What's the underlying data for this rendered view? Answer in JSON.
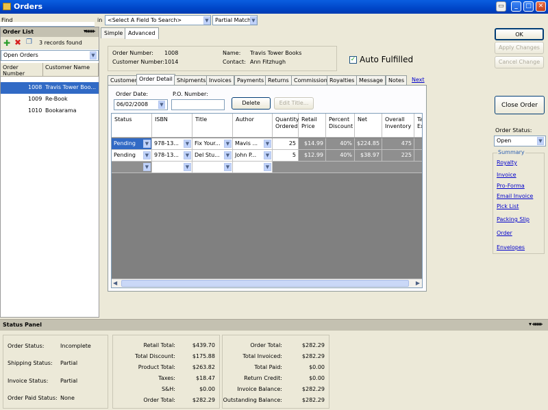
{
  "window": {
    "title": "Orders"
  },
  "find": {
    "label": "Find",
    "in_label": "in",
    "field_select": "<Select A Field To Search>",
    "match_select": "Partial Match"
  },
  "order_list": {
    "header": "Order List",
    "records_found": "3 records found",
    "filter": "Open Orders",
    "columns": [
      "Order Number",
      "Customer Name"
    ],
    "rows": [
      {
        "number": "1008",
        "name": "Travis Tower Boo..."
      },
      {
        "number": "1009",
        "name": "Re-Book"
      },
      {
        "number": "1010",
        "name": "Bookarama"
      }
    ]
  },
  "view_tabs": {
    "simple": "Simple",
    "advanced": "Advanced"
  },
  "order_info": {
    "order_number_label": "Order Number:",
    "order_number": "1008",
    "customer_number_label": "Customer Number:",
    "customer_number": "1014",
    "name_label": "Name:",
    "name": "Travis Tower Books",
    "contact_label": "Contact:",
    "contact": "Ann Fitzhugh",
    "auto_fulfilled": "Auto Fulfilled"
  },
  "tabs": [
    "Customer",
    "Order Detail",
    "Shipments",
    "Invoices",
    "Payments",
    "Returns",
    "Commission",
    "Royalties",
    "Message",
    "Notes"
  ],
  "next_link": "Next",
  "order_detail": {
    "order_date_label": "Order Date:",
    "order_date": "06/02/2008",
    "po_label": "P.O. Number:",
    "po_value": "",
    "delete_button": "Delete",
    "edit_title_button": "Edit Title..."
  },
  "grid": {
    "columns": [
      "Status",
      "ISBN",
      "Title",
      "Author",
      "Quantity Ordered",
      "Retail Price",
      "Percent Discount",
      "Net",
      "Overall Inventory",
      "Ta Ex"
    ],
    "rows": [
      {
        "status": "Pending",
        "isbn": "978-13...",
        "title": "Fix Your...",
        "author": "Mavis ...",
        "qty": "25",
        "price": "$14.99",
        "discount": "40%",
        "net": "$224.85",
        "inventory": "475"
      },
      {
        "status": "Pending",
        "isbn": "978-13...",
        "title": "Del Stu...",
        "author": "John P...",
        "qty": "5",
        "price": "$12.99",
        "discount": "40%",
        "net": "$38.97",
        "inventory": "225"
      }
    ]
  },
  "right_panel": {
    "ok": "OK",
    "apply": "Apply Changes",
    "cancel": "Cancel Change",
    "close_order": "Close Order",
    "order_status_label": "Order Status:",
    "order_status": "Open",
    "links": [
      "Summary",
      "Royalty",
      "Invoice",
      "Pro-Forma",
      "Email Invoice",
      "Pick List",
      "Packing Slip",
      "Order",
      "Envelopes"
    ]
  },
  "status_panel": {
    "header": "Status Panel",
    "order_status_label": "Order Status:",
    "order_status": "Incomplete",
    "shipping_status_label": "Shipping Status:",
    "shipping_status": "Partial",
    "invoice_status_label": "Invoice Status:",
    "invoice_status": "Partial",
    "paid_status_label": "Order Paid Status:",
    "paid_status": "None",
    "totals1": [
      {
        "label": "Retail Total:",
        "value": "$439.70"
      },
      {
        "label": "Total Discount:",
        "value": "$175.88"
      },
      {
        "label": "Product Total:",
        "value": "$263.82"
      },
      {
        "label": "Taxes:",
        "value": "$18.47"
      },
      {
        "label": "S&H:",
        "value": "$0.00"
      },
      {
        "label": "Order Total:",
        "value": "$282.29"
      }
    ],
    "totals2": [
      {
        "label": "Order Total:",
        "value": "$282.29"
      },
      {
        "label": "Total Invoiced:",
        "value": "$282.29"
      },
      {
        "label": "Total Paid:",
        "value": "$0.00"
      },
      {
        "label": "Return Credit:",
        "value": "$0.00"
      },
      {
        "label": "Invoice Balance:",
        "value": "$282.29"
      },
      {
        "label": "Outstanding Balance:",
        "value": "$282.29"
      }
    ]
  }
}
